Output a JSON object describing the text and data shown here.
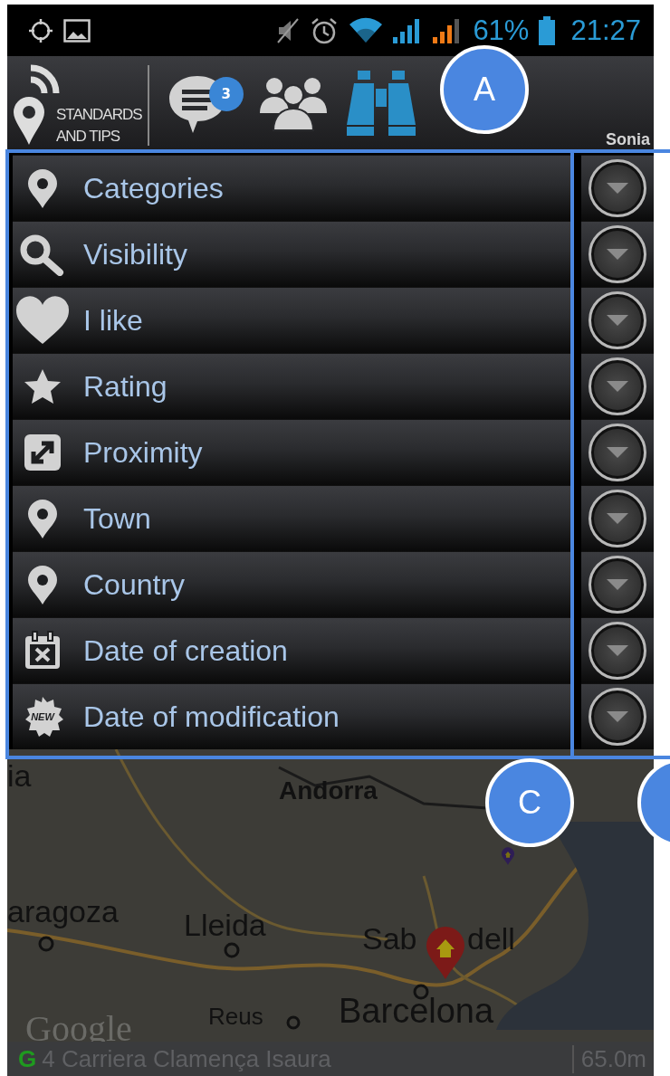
{
  "status_bar": {
    "battery": "61%",
    "time": "21:27"
  },
  "header": {
    "logo_text": [
      "STANDARDS",
      "AND TIPS"
    ],
    "tabs": [
      {
        "kind": "chat",
        "badge": "3",
        "selected": false
      },
      {
        "kind": "people",
        "selected": false
      },
      {
        "kind": "binoculars",
        "selected": true
      }
    ],
    "user": "Sonia"
  },
  "filters": [
    {
      "kind": "pin",
      "label": "Categories"
    },
    {
      "kind": "search",
      "label": "Visibility"
    },
    {
      "kind": "heart",
      "label": "I like"
    },
    {
      "kind": "star",
      "label": "Rating"
    },
    {
      "kind": "resize",
      "label": "Proximity"
    },
    {
      "kind": "pin",
      "label": "Town"
    },
    {
      "kind": "pin",
      "label": "Country"
    },
    {
      "kind": "calendar",
      "label": "Date of creation"
    },
    {
      "kind": "new",
      "label": "Date of modification",
      "icon_text": "NEW"
    }
  ],
  "map": {
    "labels": [
      {
        "text": "ia",
        "kind": "city"
      },
      {
        "text": "Andorra",
        "kind": "bold"
      },
      {
        "text": "aragoza",
        "kind": "city"
      },
      {
        "text": "Lleida",
        "kind": "city"
      },
      {
        "text": "Sab",
        "kind": "city"
      },
      {
        "text": "dell",
        "kind": "city"
      },
      {
        "text": "Google",
        "kind": "logo"
      },
      {
        "text": "Reus",
        "kind": "small"
      },
      {
        "text": "Barcelona",
        "kind": "big"
      }
    ],
    "bottom_bar": {
      "icon": "G",
      "address": "4 Carriera Clamença Isaura",
      "distance": "65.0m"
    }
  },
  "callouts": [
    {
      "label": "A"
    },
    {
      "label": "C"
    }
  ]
}
